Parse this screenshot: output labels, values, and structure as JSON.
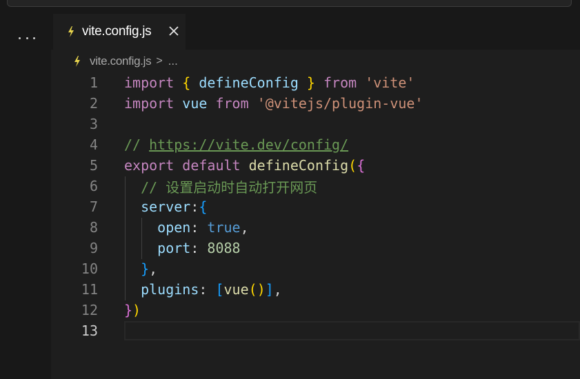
{
  "colors": {
    "background": "#1e1e1e",
    "chrome": "#181818",
    "keyword_control": "#c586c0",
    "keyword": "#569cd6",
    "variable": "#9cdcfe",
    "function": "#dcdcaa",
    "string": "#ce9178",
    "number": "#b5cea8",
    "comment": "#6a9955",
    "bracket_1": "#ffd700",
    "bracket_2": "#da70d6",
    "bracket_3": "#179fff",
    "js_icon": "#e8d44d"
  },
  "sidebar": {
    "more_icon": "more-actions-icon"
  },
  "tab": {
    "label": "vite.config.js",
    "icon": "javascript-file-icon",
    "close_icon": "close-icon",
    "close_glyph": "✕"
  },
  "breadcrumb": {
    "file": "vite.config.js",
    "separator": ">",
    "more": "..."
  },
  "editor": {
    "active_line": 13,
    "lines": [
      {
        "number": "1",
        "t1": "import",
        "t2": " ",
        "t3": "{",
        "t4": " defineConfig ",
        "t5": "}",
        "t6": " from ",
        "t7": "'vite'"
      },
      {
        "number": "2",
        "t1": "import",
        "t2": " vue ",
        "t3": "from",
        "t4": " ",
        "t5": "'@vitejs/plugin-vue'"
      },
      {
        "number": "3"
      },
      {
        "number": "4",
        "t1": "// ",
        "t2": "https://vite.dev/config/"
      },
      {
        "number": "5",
        "t1": "export",
        "t2": " ",
        "t3": "default",
        "t4": " ",
        "t5": "defineConfig",
        "t6": "(",
        "t7": "{"
      },
      {
        "number": "6",
        "t1": "  // 设置启动时自动打开网页"
      },
      {
        "number": "7",
        "t1": "  server",
        "t2": ":",
        "t3": "{"
      },
      {
        "number": "8",
        "t1": "    open",
        "t2": ": ",
        "t3": "true",
        "t4": ","
      },
      {
        "number": "9",
        "t1": "    port",
        "t2": ": ",
        "t3": "8088"
      },
      {
        "number": "10",
        "t1": "  ",
        "t2": "}",
        "t3": ","
      },
      {
        "number": "11",
        "t1": "  plugins",
        "t2": ": ",
        "t3": "[",
        "t4": "vue",
        "t5": "(",
        "t6": ")",
        "t7": "]",
        "t8": ","
      },
      {
        "number": "12",
        "t1": "}",
        "t2": ")"
      },
      {
        "number": "13"
      }
    ]
  }
}
